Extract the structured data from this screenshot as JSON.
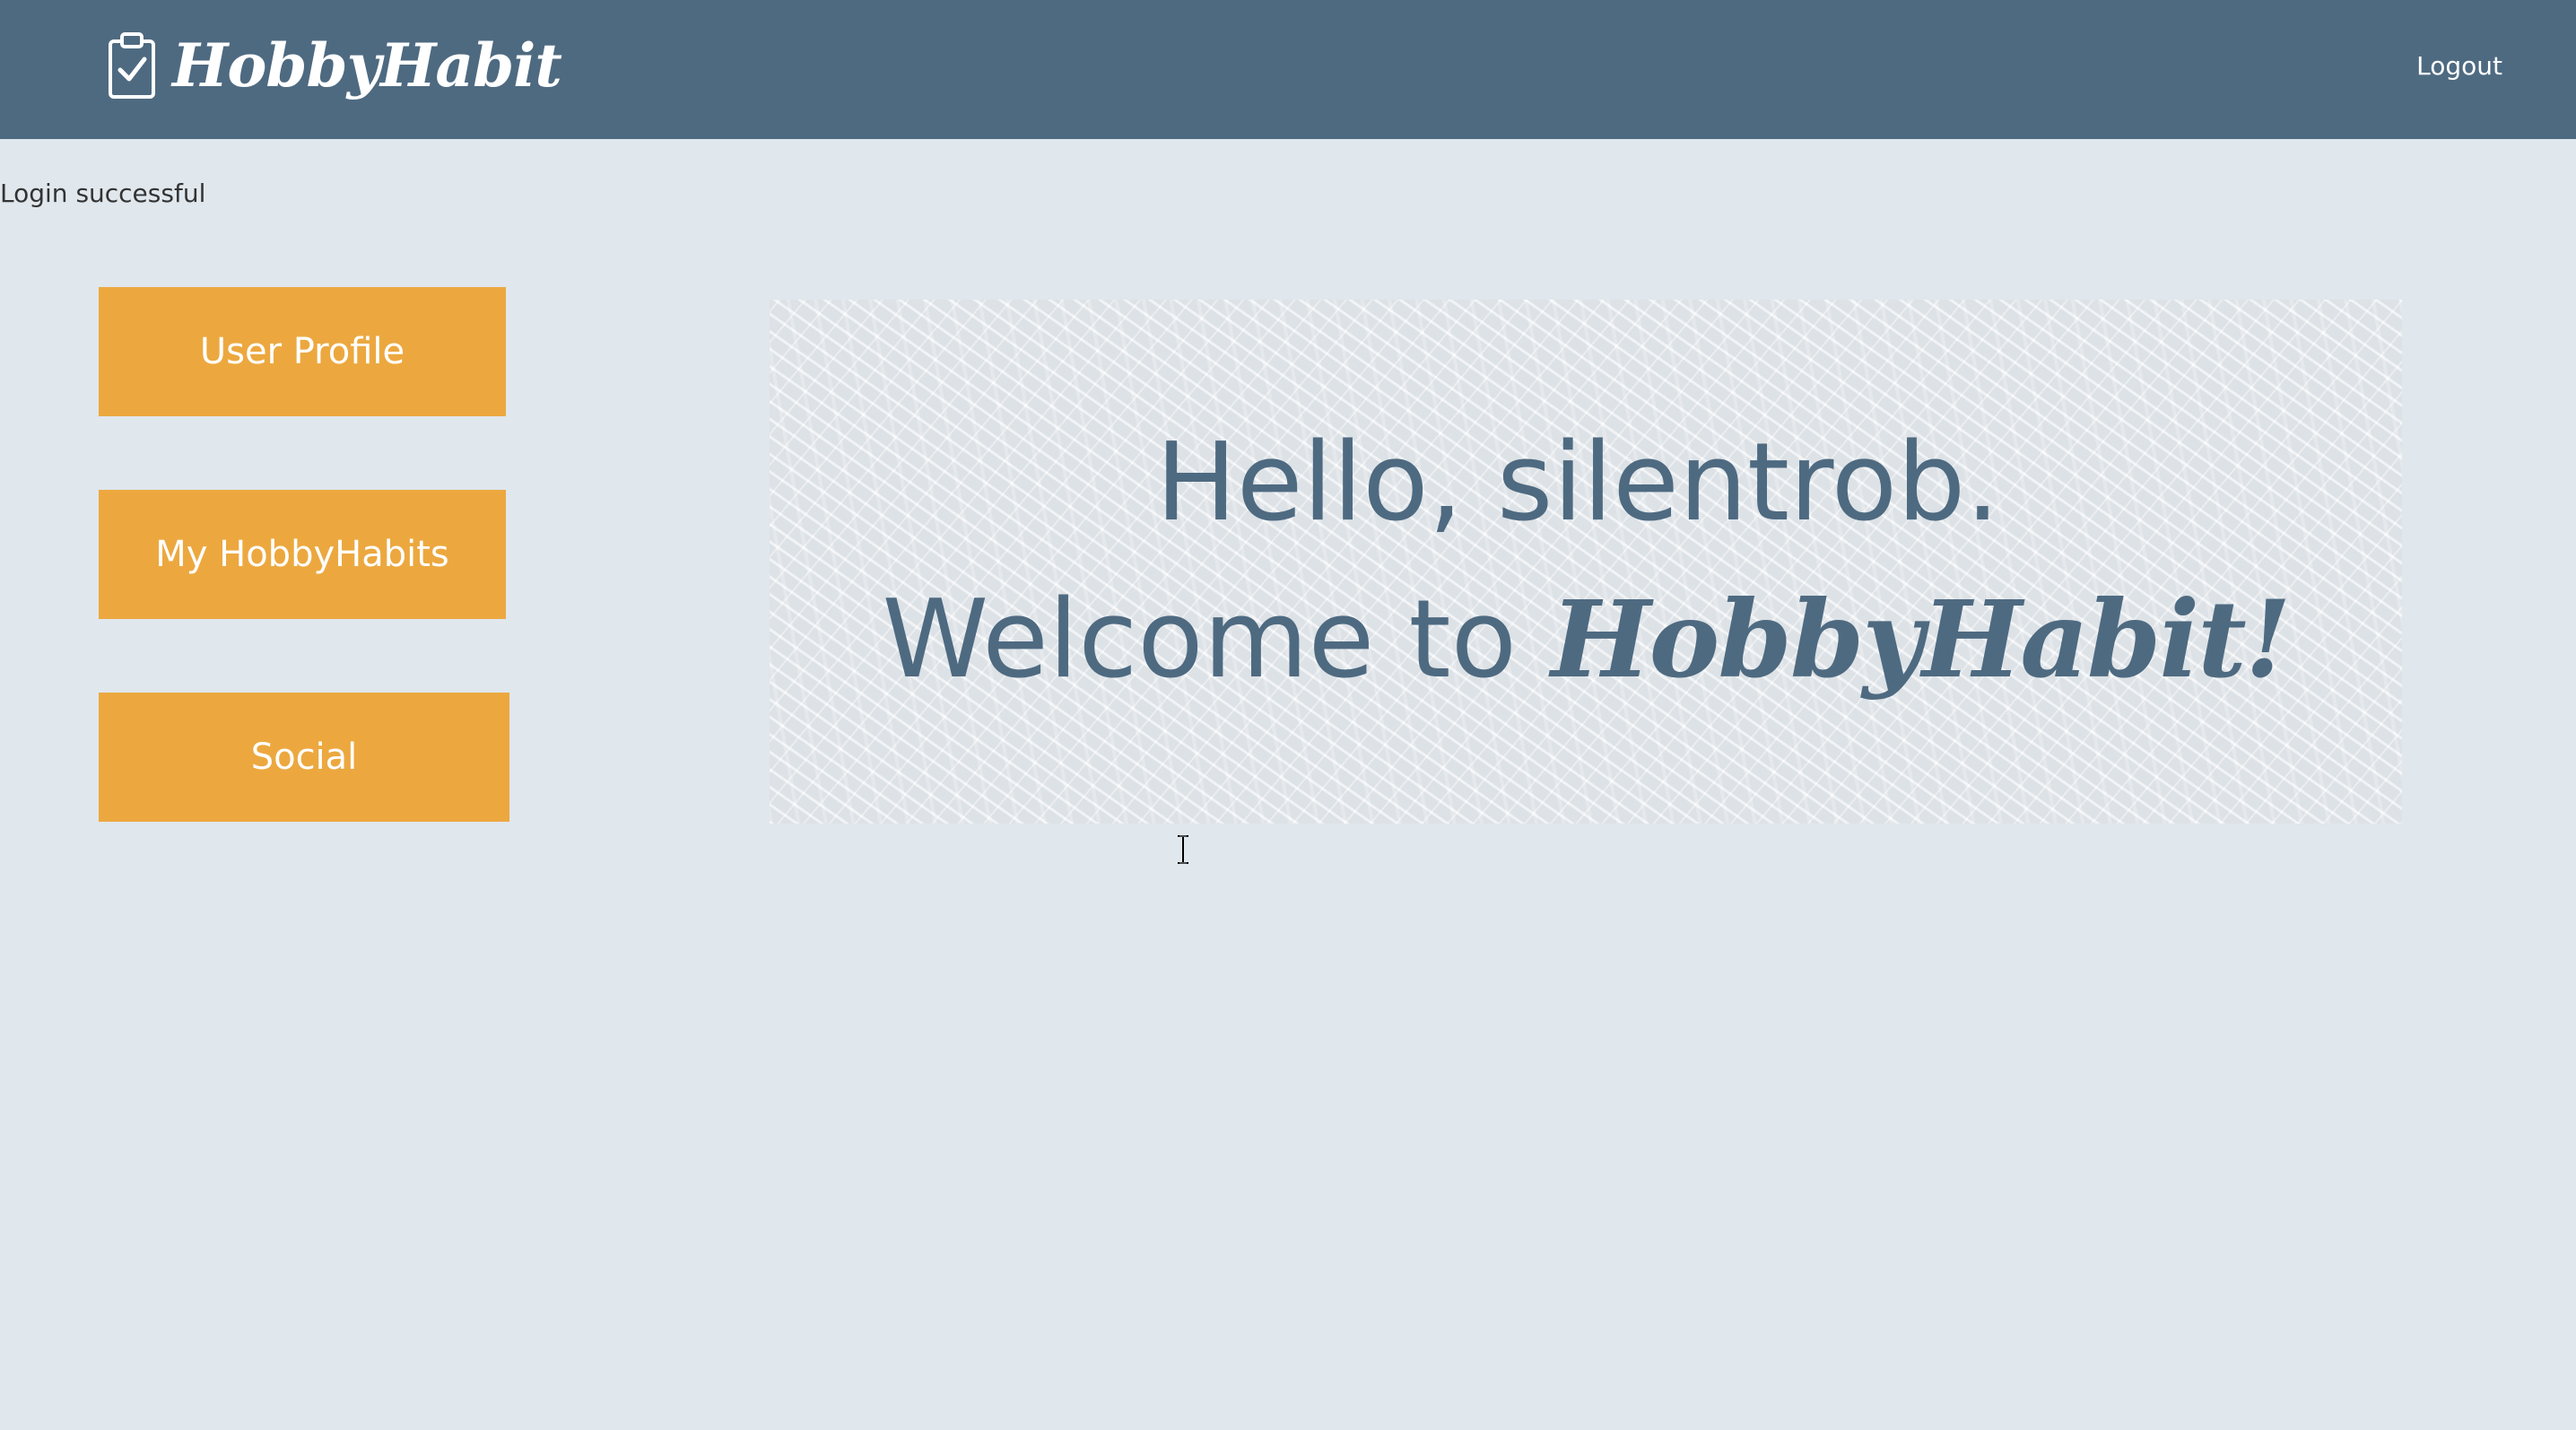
{
  "navbar": {
    "brand": "HobbyHabit",
    "logo_icon": "clipboard-check-icon",
    "logout_label": "Logout",
    "background": "#4e6a81"
  },
  "flash_message": "Login successful",
  "sidebar": {
    "button_color": "#eca83f",
    "items": [
      {
        "label": "User Profile"
      },
      {
        "label": "My HobbyHabits"
      },
      {
        "label": "Social"
      }
    ]
  },
  "banner": {
    "greeting": "Hello, silentrob.",
    "welcome_prefix": "Welcome to",
    "brand": "HobbyHabit",
    "exclamation": "!"
  },
  "cursor": "text-cursor-icon"
}
